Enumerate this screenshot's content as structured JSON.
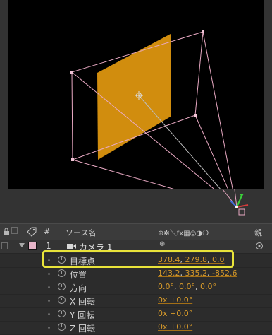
{
  "header": {
    "col_hash": "#",
    "col_source": "ソース名",
    "col_switches": "⊕✲＼fx▦◎◑❍",
    "col_parent": "親"
  },
  "layer": {
    "number": "1",
    "name": "カメラ 1",
    "swatch_color": "#e6b4c8"
  },
  "properties": [
    {
      "label": "目標点",
      "v1": "378.4",
      "v2": "279.8",
      "v3": "0.0",
      "highlighted": true
    },
    {
      "label": "位置",
      "v1": "143.2",
      "v2": "335.2",
      "v3": "-852.6"
    },
    {
      "label": "方向",
      "v1": "0.0°",
      "v2": "0.0°",
      "v3": "0.0°"
    },
    {
      "label": "X 回転",
      "v1": "0x +0.0°"
    },
    {
      "label": "Y 回転",
      "v1": "0x +0.0°"
    },
    {
      "label": "Z 回転",
      "v1": "0x +0.0°"
    }
  ],
  "colors": {
    "solid": "#d18d0e",
    "camera_wire": "#e9a9c3",
    "highlight_box": "#e8e33a",
    "value_text": "#d79a2a"
  },
  "icons": [
    "stopwatch-icon",
    "camera-icon",
    "label-tag-icon",
    "lock-icon",
    "twirl-down-icon",
    "parent-pickwhip-icon"
  ]
}
